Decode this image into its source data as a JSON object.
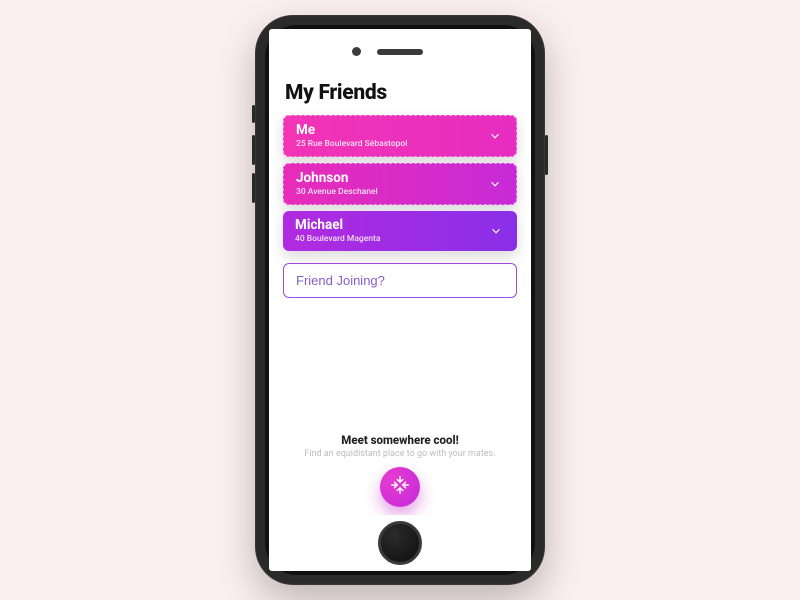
{
  "header": {
    "title": "My Friends"
  },
  "friends": [
    {
      "name": "Me",
      "address": "25 Rue Boulevard Sébastopol"
    },
    {
      "name": "Johnson",
      "address": "30 Avenue Deschanel"
    },
    {
      "name": "Michael",
      "address": "40 Boulevard Magenta"
    }
  ],
  "add_friend": {
    "placeholder": "Friend Joining?"
  },
  "footer": {
    "headline": "Meet somewhere cool!",
    "subtitle": "Find an equidistant place to go with your mates."
  },
  "colors": {
    "gradient_start": "#f234b5",
    "gradient_end": "#8a2fe8",
    "accent": "#c22ad9"
  }
}
